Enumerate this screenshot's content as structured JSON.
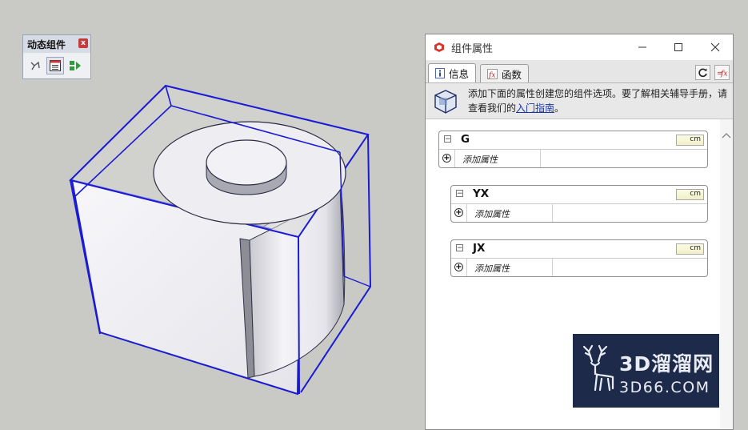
{
  "toolbar": {
    "title": "动态组件",
    "close_label": "x",
    "tools": [
      {
        "name": "interact-icon"
      },
      {
        "name": "component-options-icon"
      },
      {
        "name": "component-attributes-icon"
      }
    ]
  },
  "window": {
    "title": "组件属性",
    "tabs": [
      {
        "label": "信息",
        "icon": "info-icon",
        "active": true
      },
      {
        "label": "函数",
        "icon": "function-icon",
        "active": false
      }
    ],
    "info_text": "添加下面的属性创建您的组件选项。要了解相关辅导手册，请查看我们的",
    "info_link": "入门指南",
    "info_end": "。"
  },
  "components": [
    {
      "name": "G",
      "unit": "cm",
      "add_label": "添加属性"
    },
    {
      "name": "YX",
      "unit": "cm",
      "add_label": "添加属性"
    },
    {
      "name": "JX",
      "unit": "cm",
      "add_label": "添加属性"
    }
  ],
  "watermark": {
    "text_cn": "3D溜溜网",
    "text_en": "3D66.COM"
  },
  "colors": {
    "selection_blue": "#1a1ad6",
    "viewport_bg": "#c9cac5",
    "link_blue": "#1a35a8"
  }
}
